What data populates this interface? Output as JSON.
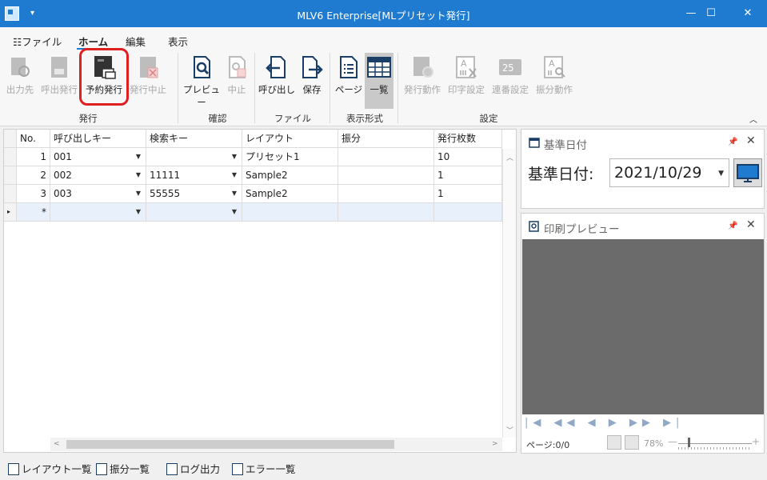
{
  "window": {
    "title": "MLV6 Enterprise[MLプリセット発行]",
    "minimize": "—",
    "maximize": "☐",
    "close": "✕",
    "quick_access": "▾"
  },
  "ribbon_tabs": [
    "ファイル",
    "ホーム",
    "編集",
    "表示"
  ],
  "ribbon_groups": {
    "issue": {
      "label": "発行",
      "buttons": [
        "出力先",
        "呼出発行",
        "予約発行",
        "発行中止"
      ]
    },
    "confirm": {
      "label": "確認",
      "buttons": [
        "プレビュー",
        "中止"
      ]
    },
    "file": {
      "label": "ファイル",
      "buttons": [
        "呼び出し",
        "保存"
      ]
    },
    "display": {
      "label": "表示形式",
      "buttons": [
        "ページ",
        "一覧"
      ]
    },
    "settings": {
      "label": "設定",
      "buttons": [
        "発行動作",
        "印字設定",
        "連番設定",
        "振分動作"
      ]
    }
  },
  "grid": {
    "columns": [
      "No.",
      "呼び出しキー",
      "検索キー",
      "レイアウト",
      "振分",
      "発行枚数"
    ],
    "rows": [
      {
        "no": "1",
        "call_key": "001",
        "search_key": "",
        "layout": "プリセット1",
        "sort": "",
        "count": "10"
      },
      {
        "no": "2",
        "call_key": "002",
        "search_key": "11111",
        "layout": "Sample2",
        "sort": "",
        "count": "1"
      },
      {
        "no": "3",
        "call_key": "003",
        "search_key": "55555",
        "layout": "Sample2",
        "sort": "",
        "count": "1"
      }
    ],
    "new_row_marker": "*"
  },
  "date_panel": {
    "title": "基準日付",
    "label": "基準日付:",
    "value": "2021/10/29"
  },
  "preview_panel": {
    "title": "印刷プレビュー",
    "page": "ページ:0/0",
    "zoom": "78%",
    "nav": "|◀ ◀◀ ◀ ▶ ▶▶ ▶|"
  },
  "statusbar": [
    "レイアウト一覧",
    "振分一覧",
    "ログ出力",
    "エラー一覧"
  ],
  "colors": {
    "titlebar": "#1f7bd0",
    "highlight": "#e02020",
    "preview_bg": "#6b6b6b"
  }
}
